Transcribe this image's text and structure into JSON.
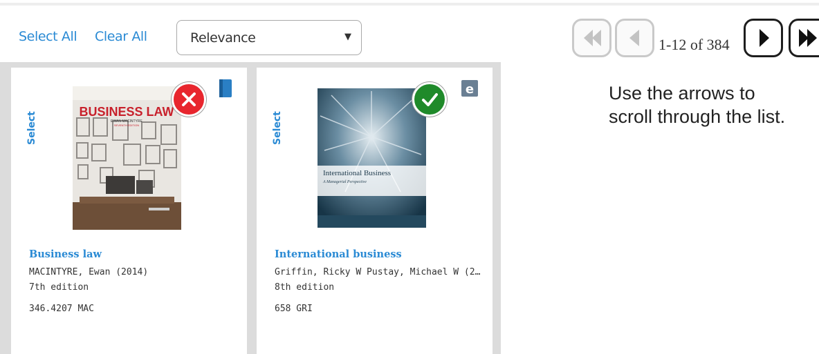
{
  "toolbar": {
    "select_all": "Select All",
    "clear_all": "Clear All",
    "sort": {
      "selected": "Relevance"
    }
  },
  "pager": {
    "range": "1-12 of 384"
  },
  "help": {
    "line1": "Use the arrows to",
    "line2": "scroll through the list."
  },
  "results": [
    {
      "select_label": "Select",
      "cover_title": "BUSINESS LAW",
      "cover_author": "EWAN MACINTYRE",
      "cover_edition": "SEVENTH EDITION",
      "title": "Business law",
      "author": "MACINTYRE, Ewan  (2014)",
      "edition": "7th edition",
      "call_number": "346.4207 MAC",
      "status": "removed",
      "type_icon": "book-icon"
    },
    {
      "select_label": "Select",
      "cover_title": "International Business",
      "cover_subtitle": "A Managerial Perspective",
      "title": "International business",
      "author": "Griffin, Ricky W Pustay, Michael W  (2…",
      "edition": "8th edition",
      "call_number": "658 GRI",
      "status": "selected",
      "type_icon": "ebook-icon"
    }
  ],
  "colors": {
    "link": "#2a8ad4",
    "remove": "#e8262e",
    "selected": "#1f8a2a",
    "grid_bg": "#dcdcdc"
  }
}
